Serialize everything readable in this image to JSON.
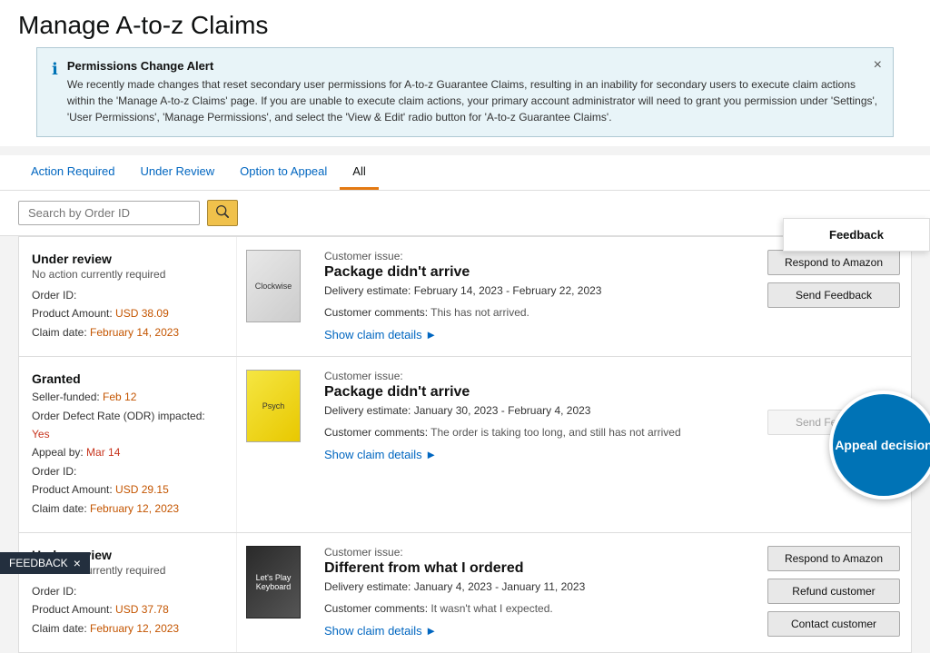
{
  "page": {
    "title": "Manage A-to-z Claims"
  },
  "alert": {
    "title": "Permissions Change Alert",
    "text": "We recently made changes that reset secondary user permissions for A-to-z Guarantee Claims, resulting in an inability for secondary users to execute claim actions within the 'Manage A-to-z Claims' page. If you are unable to execute claim actions, your primary account administrator will need to grant you permission under 'Settings', 'User Permissions', 'Manage Permissions', and select the 'View & Edit' radio button for 'A-to-z Guarantee Claims'.",
    "close_label": "×"
  },
  "tabs": [
    {
      "id": "action-required",
      "label": "Action Required"
    },
    {
      "id": "under-review",
      "label": "Under Review"
    },
    {
      "id": "option-to-appeal",
      "label": "Option to Appeal"
    },
    {
      "id": "all",
      "label": "All"
    }
  ],
  "search": {
    "placeholder": "Search by Order ID"
  },
  "claims": [
    {
      "id": "claim-1",
      "status": "Under review",
      "note": "No action currently required",
      "order_id_label": "Order ID:",
      "order_id": "",
      "product_amount_label": "Product Amount:",
      "product_amount": "USD 38.09",
      "claim_date_label": "Claim date:",
      "claim_date": "February 14, 2023",
      "book_style": "clockwise",
      "customer_issue_label": "Customer issue:",
      "issue_title": "Package didn't arrive",
      "delivery_estimate_label": "Delivery estimate:",
      "delivery_estimate": "February 14, 2023 - February 22, 2023",
      "comments_label": "Customer comments:",
      "comments": "This has not arrived.",
      "show_details": "Show claim details",
      "actions": [
        {
          "label": "Respond to Amazon",
          "type": "secondary"
        },
        {
          "label": "Send Feedback",
          "type": "secondary"
        }
      ]
    },
    {
      "id": "claim-2",
      "status": "Granted",
      "note": "",
      "seller_funded_label": "Seller-funded:",
      "seller_funded": "Feb 12",
      "odr_label": "Order Defect Rate (ODR) impacted:",
      "odr_value": "Yes",
      "appeal_by_label": "Appeal by:",
      "appeal_by": "Mar 14",
      "order_id_label": "Order ID:",
      "order_id": "",
      "product_amount_label": "Product Amount:",
      "product_amount": "USD 29.15",
      "claim_date_label": "Claim date:",
      "claim_date": "February 12, 2023",
      "book_style": "psychology",
      "customer_issue_label": "Customer issue:",
      "issue_title": "Package didn't arrive",
      "delivery_estimate_label": "Delivery estimate:",
      "delivery_estimate": "January 30, 2023 - February 4, 2023",
      "comments_label": "Customer comments:",
      "comments": "The order is taking too long, and still has not arrived",
      "show_details": "Show claim details",
      "actions": [
        {
          "label": "Appeal decision",
          "type": "primary"
        },
        {
          "label": "Send Feedback",
          "type": "secondary"
        }
      ],
      "has_appeal_circle": true,
      "appeal_label": "Appeal decision"
    },
    {
      "id": "claim-3",
      "status": "Under review",
      "note": "No action currently required",
      "order_id_label": "Order ID:",
      "order_id": "",
      "product_amount_label": "Product Amount:",
      "product_amount": "USD 37.78",
      "claim_date_label": "Claim date:",
      "claim_date": "February 12, 2023",
      "book_style": "keyboard",
      "customer_issue_label": "Customer issue:",
      "issue_title": "Different from what I ordered",
      "delivery_estimate_label": "Delivery estimate:",
      "delivery_estimate": "January 4, 2023 - January 11, 2023",
      "comments_label": "Customer comments:",
      "comments": "It wasn't what I expected.",
      "show_details": "Show claim details",
      "actions": [
        {
          "label": "Respond to Amazon",
          "type": "secondary"
        },
        {
          "label": "Refund customer",
          "type": "secondary"
        },
        {
          "label": "Contact customer",
          "type": "secondary"
        }
      ]
    }
  ],
  "feedback": {
    "bar_label": "FEEDBACK",
    "close_label": "×",
    "panel_label": "Feedback"
  }
}
